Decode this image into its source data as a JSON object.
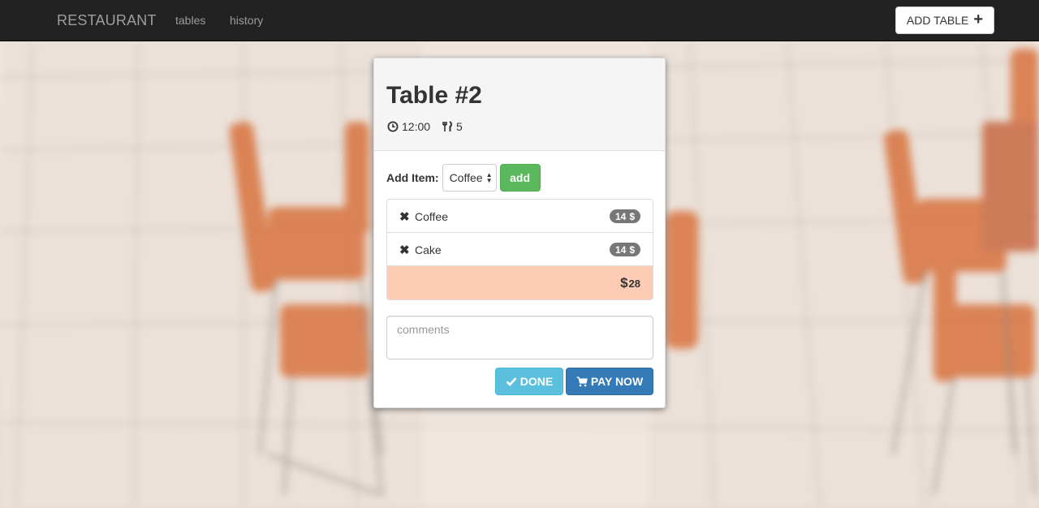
{
  "navbar": {
    "brand": "RESTAURANT",
    "links": [
      {
        "label": "tables"
      },
      {
        "label": "history"
      }
    ],
    "add_table_label": "ADD TABLE",
    "add_table_icon": "plus-icon"
  },
  "table": {
    "title": "Table #2",
    "time": "12:00",
    "time_icon": "clock-icon",
    "guests": "5",
    "guests_icon": "cutlery-icon"
  },
  "add_item": {
    "label": "Add Item:",
    "selected": "Coffee",
    "button_label": "add"
  },
  "order": {
    "items": [
      {
        "name": "Coffee",
        "price": "14",
        "currency": "$",
        "remove_icon": "remove-icon"
      },
      {
        "name": "Cake",
        "price": "14",
        "currency": "$",
        "remove_icon": "remove-icon"
      }
    ],
    "total_currency": "$",
    "total": "28"
  },
  "comments": {
    "placeholder": "comments",
    "value": ""
  },
  "actions": {
    "done_label": "DONE",
    "done_icon": "checkmark-icon",
    "pay_label": "PAY NOW",
    "pay_icon": "cart-icon"
  },
  "colors": {
    "navbar": "#222222",
    "add_button": "#5cb85c",
    "total_row": "#fecbb4",
    "done_button": "#5bc0de",
    "pay_button": "#337ab7",
    "badge": "#777777"
  }
}
